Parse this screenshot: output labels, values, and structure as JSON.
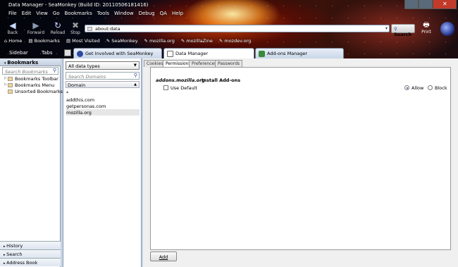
{
  "window": {
    "title": "Data Manager - SeaMonkey (Build ID: 20110506181416)"
  },
  "menu": [
    "File",
    "Edit",
    "View",
    "Go",
    "Bookmarks",
    "Tools",
    "Window",
    "Debug",
    "QA",
    "Help"
  ],
  "nav": {
    "back": "Back",
    "forward": "Forward",
    "reload": "Reload",
    "stop": "Stop",
    "url": "about:data",
    "search": "Search",
    "print": "Print"
  },
  "bookmarks_bar": [
    "Home",
    "Bookmarks",
    "Most Visited",
    "SeaMonkey",
    "mozilla.org",
    "mozillaZine",
    "mozdev.org"
  ],
  "sidebar": {
    "tabs": [
      "Sidebar",
      "Tabs"
    ],
    "header": "Bookmarks",
    "search_placeholder": "Search Bookmarks",
    "items": [
      "Bookmarks Toolbar",
      "Bookmarks Menu",
      "Unsorted Bookmarks"
    ],
    "footer": [
      "History",
      "Search",
      "Address Book"
    ]
  },
  "tabs": [
    "Get Involved with SeaMonkey",
    "Data Manager",
    "Add-ons Manager"
  ],
  "data_manager": {
    "type_select": "All data types",
    "domain_search_placeholder": "Search Domains",
    "domain_header": "Domain",
    "domains": [
      "*",
      "addthis.com",
      "getpersonas.com",
      "mozilla.org"
    ],
    "panel_tabs": [
      "Cookies",
      "Permissions",
      "Preferences",
      "Passwords"
    ],
    "permission": {
      "site": "addons.mozilla.org",
      "name": "Install Add-ons",
      "use_default": "Use Default",
      "allow": "Allow",
      "block": "Block",
      "selected": "Allow"
    },
    "add_button": "Add"
  },
  "colors": {
    "accent": "#2a4ba0",
    "selected_row": "#e6e6e6"
  }
}
